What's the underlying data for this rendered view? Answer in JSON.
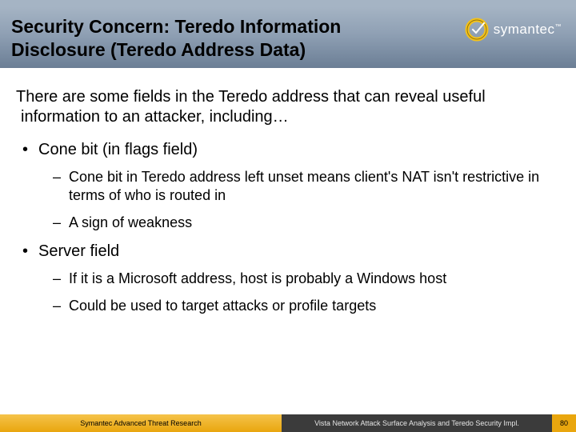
{
  "header": {
    "title": "Security Concern: Teredo Information Disclosure (Teredo Address Data)",
    "brand": "symantec",
    "brand_tm": "™"
  },
  "intro": "There are some fields in the Teredo address that can reveal useful information to an attacker, including…",
  "bullets": [
    {
      "text": "Cone bit (in flags field)",
      "sub": [
        "Cone bit in Teredo address left unset means client's NAT isn't restrictive in terms of who is routed in",
        "A sign of weakness"
      ]
    },
    {
      "text": "Server field",
      "sub": [
        "If it is a Microsoft address, host is probably a Windows host",
        "Could be used to target attacks or profile targets"
      ]
    }
  ],
  "footer": {
    "left": "Symantec Advanced Threat Research",
    "center": "Vista Network Attack Surface Analysis and Teredo Security Impl.",
    "page": "80"
  }
}
